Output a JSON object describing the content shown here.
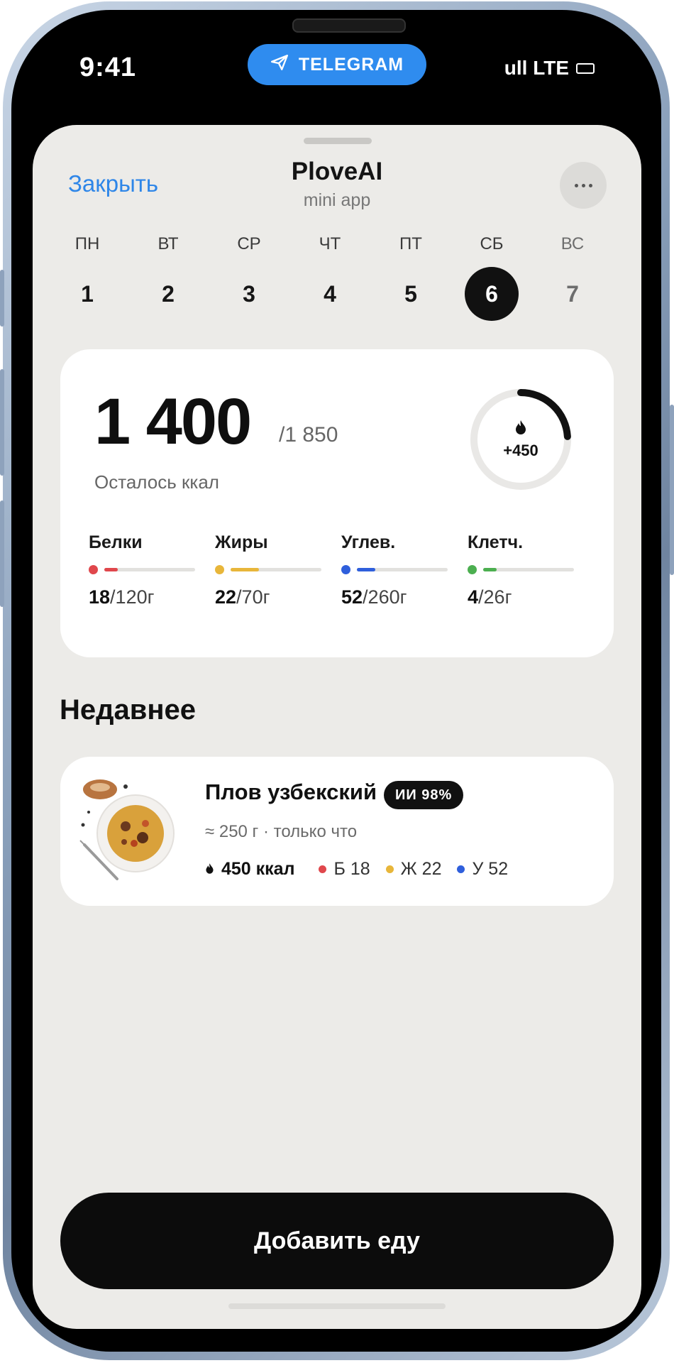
{
  "status_bar": {
    "time": "9:41",
    "carrier": "ull LTE",
    "telegram_label": "TELEGRAM"
  },
  "header": {
    "close_label": "Закрыть",
    "title": "PloveAI",
    "subtitle": "mini app",
    "more_label": "···"
  },
  "week": [
    {
      "name": "ПН",
      "num": "1",
      "state": "normal"
    },
    {
      "name": "ВТ",
      "num": "2",
      "state": "normal"
    },
    {
      "name": "СР",
      "num": "3",
      "state": "normal"
    },
    {
      "name": "ЧТ",
      "num": "4",
      "state": "normal"
    },
    {
      "name": "ПТ",
      "num": "5",
      "state": "normal"
    },
    {
      "name": "СБ",
      "num": "6",
      "state": "active"
    },
    {
      "name": "ВС",
      "num": "7",
      "state": "dim"
    }
  ],
  "summary": {
    "remaining": "1 400",
    "goal": "/1 850",
    "remaining_label": "Осталось ккал",
    "ring_value": "+450",
    "ring_progress": 0.24
  },
  "macros": [
    {
      "name": "Белки",
      "current": "18",
      "target": "/120г",
      "color": "#e0474c",
      "progress": 0.15
    },
    {
      "name": "Жиры",
      "current": "22",
      "target": "/70г",
      "color": "#e8b63a",
      "progress": 0.31
    },
    {
      "name": "Углев.",
      "current": "52",
      "target": "/260г",
      "color": "#2f5fdc",
      "progress": 0.2
    },
    {
      "name": "Клетч.",
      "current": "4",
      "target": "/26г",
      "color": "#4caf50",
      "progress": 0.15
    }
  ],
  "recent": {
    "title": "Недавнее",
    "item": {
      "name": "Плов узбекский",
      "badge": "ИИ 98%",
      "meta": "≈ 250 г · только что",
      "kcal": "450 ккал",
      "protein": "Б 18",
      "fat": "Ж 22",
      "carbs": "У 52"
    }
  },
  "add_button": "Добавить еду"
}
